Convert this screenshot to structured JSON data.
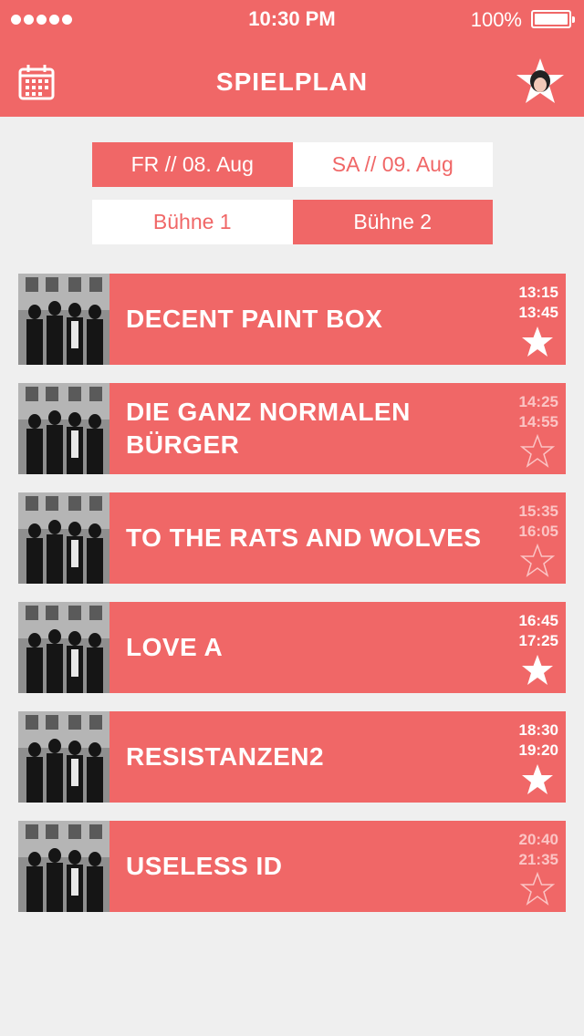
{
  "status_bar": {
    "time": "10:30 PM",
    "battery": "100%",
    "signal_icon": "signal-dots-icon",
    "battery_icon": "battery-icon"
  },
  "nav": {
    "title": "SPIELPLAN",
    "left_icon": "calendar-icon",
    "right_icon": "avatar-star-icon"
  },
  "days": [
    {
      "label": "FR // 08. Aug",
      "active": true
    },
    {
      "label": "SA // 09. Aug",
      "active": false
    }
  ],
  "stages": [
    {
      "label": "Bühne 1",
      "active": false
    },
    {
      "label": "Bühne 2",
      "active": true
    }
  ],
  "colors": {
    "accent": "#f06767",
    "background": "#efefef",
    "inactive_time": "#fbc4c4"
  },
  "performances": [
    {
      "band": "DECENT PAINT BOX",
      "start": "13:15",
      "end": "13:45",
      "favorite": true
    },
    {
      "band": "DIE GANZ NORMALEN BÜRGER",
      "start": "14:25",
      "end": "14:55",
      "favorite": false
    },
    {
      "band": "TO THE RATS AND WOLVES",
      "start": "15:35",
      "end": "16:05",
      "favorite": false
    },
    {
      "band": "LOVE A",
      "start": "16:45",
      "end": "17:25",
      "favorite": true
    },
    {
      "band": "RESISTANZEN2",
      "start": "18:30",
      "end": "19:20",
      "favorite": true
    },
    {
      "band": "USELESS ID",
      "start": "20:40",
      "end": "21:35",
      "favorite": false
    }
  ]
}
